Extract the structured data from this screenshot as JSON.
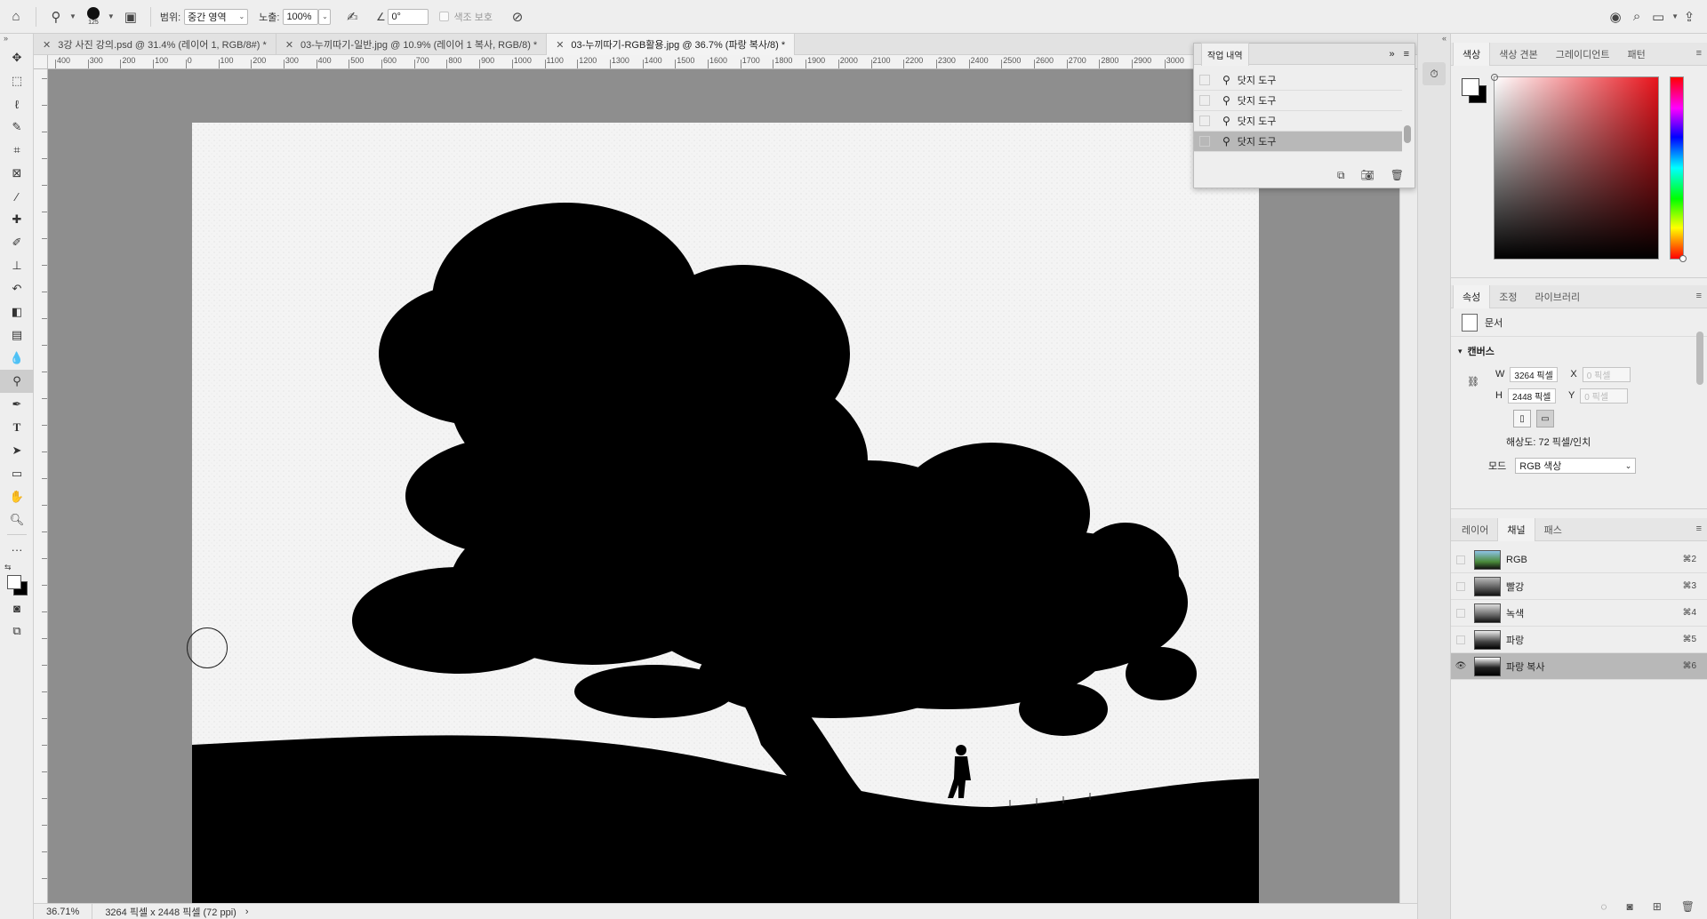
{
  "options_bar": {
    "brush_size": "125",
    "range_label": "범위:",
    "range_value": "중간 영역",
    "exposure_label": "노출:",
    "exposure_value": "100%",
    "angle_value": "0°",
    "protect_tones_label": "색조 보호"
  },
  "tabs": [
    {
      "label": "3강 사진 강의.psd @ 31.4% (레이어 1, RGB/8#) *"
    },
    {
      "label": "03-누끼따기-일반.jpg @ 10.9% (레이어 1 복사, RGB/8) *"
    },
    {
      "label": "03-누끼따기-RGB활용.jpg @ 36.7% (파랑 복사/8) *"
    }
  ],
  "ruler": {
    "top_labels": [
      "400",
      "300",
      "200",
      "100",
      "0",
      "100",
      "200",
      "300",
      "400",
      "500",
      "600",
      "700",
      "800",
      "900",
      "1000",
      "1100",
      "1200",
      "1300",
      "1400",
      "1500",
      "1600",
      "1700",
      "1800",
      "1900",
      "2000",
      "2100",
      "2200",
      "2300",
      "2400",
      "2500",
      "2600",
      "2700",
      "2800",
      "2900",
      "3000"
    ]
  },
  "status": {
    "zoom": "36.71%",
    "info": "3264 픽셀 x 2448 픽셀 (72 ppi)"
  },
  "history": {
    "title": "작업 내역",
    "items": [
      "닷지 도구",
      "닷지 도구",
      "닷지 도구",
      "닷지 도구"
    ]
  },
  "color_panel": {
    "tabs": [
      "색상",
      "색상 견본",
      "그레이디언트",
      "패턴"
    ]
  },
  "props_panel": {
    "tabs": [
      "속성",
      "조정",
      "라이브러리"
    ],
    "doc_label": "문서",
    "section": "캔버스",
    "w_label": "W",
    "w_value": "3264 픽셀",
    "h_label": "H",
    "h_value": "2448 픽셀",
    "x_label": "X",
    "x_placeholder": "0 픽셀",
    "y_label": "Y",
    "y_placeholder": "0 픽셀",
    "resolution": "해상도: 72 픽셀/인치",
    "mode_label": "모드",
    "mode_value": "RGB 색상"
  },
  "channels_panel": {
    "tabs": [
      "레이어",
      "채널",
      "패스"
    ],
    "channels": [
      {
        "name": "RGB",
        "shortcut": "⌘2"
      },
      {
        "name": "빨강",
        "shortcut": "⌘3"
      },
      {
        "name": "녹색",
        "shortcut": "⌘4"
      },
      {
        "name": "파랑",
        "shortcut": "⌘5"
      },
      {
        "name": "파랑 복사",
        "shortcut": "⌘6"
      }
    ]
  },
  "colors": {
    "accent_selected": "#b8b8b8",
    "pasteboard": "#8e8e8e",
    "picker_hue": "#e8141c"
  }
}
